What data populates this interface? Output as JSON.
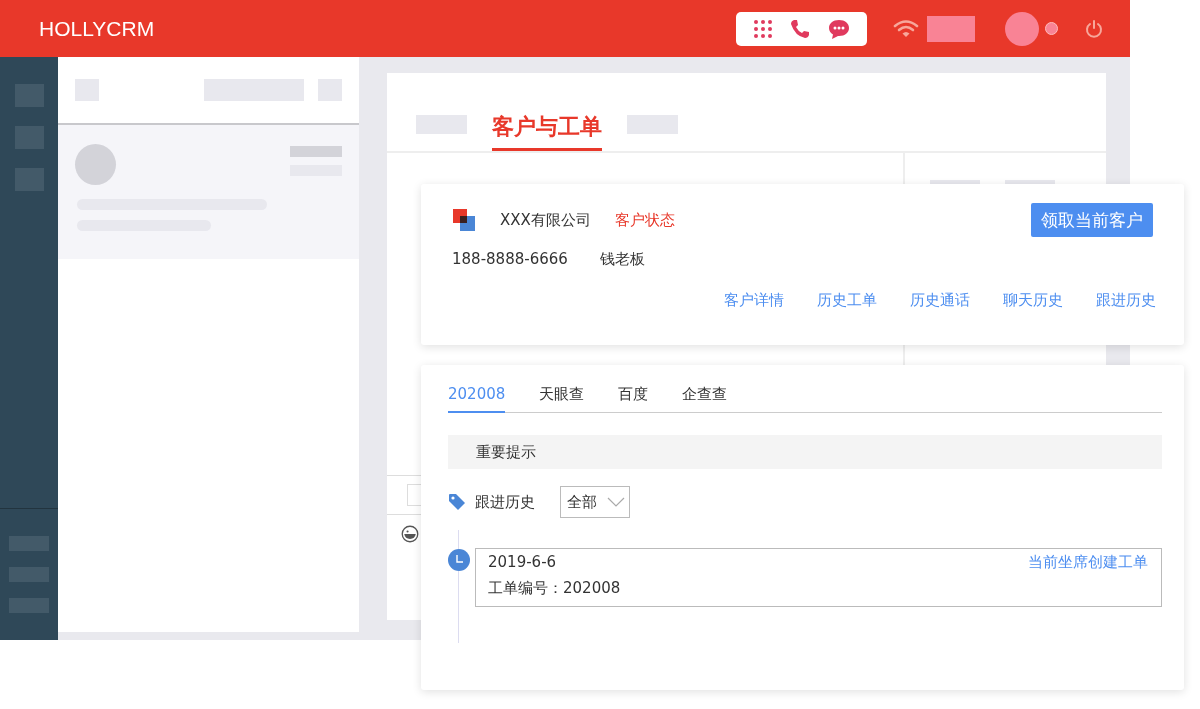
{
  "header": {
    "logo": "HOLLYCRM"
  },
  "main_tabs": [
    {
      "label": "客户与工单",
      "selected": true
    }
  ],
  "customer": {
    "company": "XXX有限公司",
    "status": "客户状态",
    "phone": "188-8888-6666",
    "contact": "钱老板",
    "claim_button": "领取当前客户",
    "links": [
      "客户详情",
      "历史工单",
      "历史通话",
      "聊天历史",
      "跟进历史"
    ]
  },
  "info_tabs": [
    {
      "label": "202008",
      "selected": true
    },
    {
      "label": "天眼查",
      "selected": false
    },
    {
      "label": "百度",
      "selected": false
    },
    {
      "label": "企查查",
      "selected": false
    }
  ],
  "notice": "重要提示",
  "follow_up": {
    "title": "跟进历史",
    "filter": "全部",
    "entries": [
      {
        "date": "2019-6-6",
        "action": "当前坐席创建工单",
        "ticket": "工单编号：202008"
      }
    ]
  }
}
